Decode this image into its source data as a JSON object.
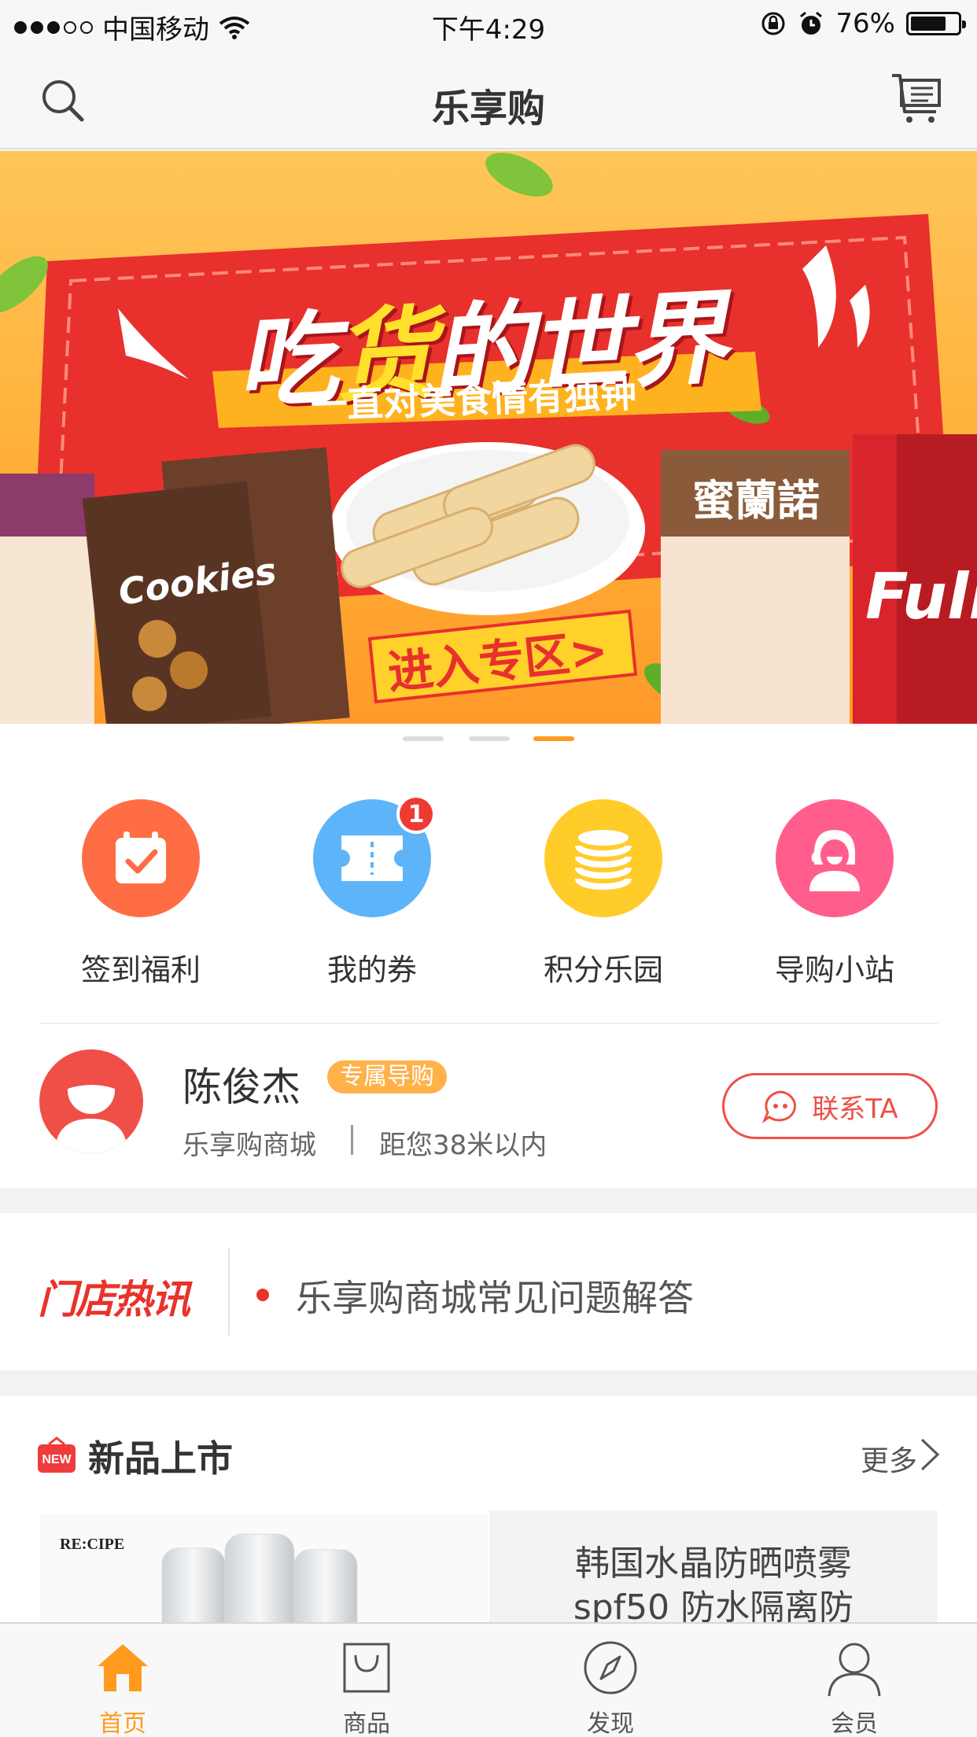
{
  "status_bar": {
    "carrier": "中国移动",
    "time": "下午4:29",
    "battery": "76%",
    "battery_level": 0.76
  },
  "nav": {
    "title": "乐享购"
  },
  "banner": {
    "headline_part1": "吃",
    "headline_part2": "货",
    "headline_part3": "的世界",
    "subline": "一直对美食情有独钟",
    "cta": "进入专区>",
    "carousel_count": 3,
    "carousel_active": 3,
    "brand_text_1": "蜜蘭諾",
    "brand_text_2": "Cookies",
    "brand_text_3": "Full"
  },
  "quick_menu": [
    {
      "label": "签到福利",
      "color": "#ff6d45",
      "icon": "calendar-check-icon"
    },
    {
      "label": "我的券",
      "color": "#5db4f9",
      "icon": "ticket-icon",
      "badge": "1"
    },
    {
      "label": "积分乐园",
      "color": "#ffcc2a",
      "icon": "coins-icon"
    },
    {
      "label": "导购小站",
      "color": "#ff5e8c",
      "icon": "guide-girl-icon"
    }
  ],
  "guide": {
    "name": "陈俊杰",
    "tag": "专属导购",
    "store": "乐享购商城",
    "distance": "距您38米以内",
    "contact": "联系TA"
  },
  "news": {
    "logo": "门店热讯",
    "headline": "乐享购商城常见问题解答"
  },
  "new_products": {
    "icon_text": "NEW",
    "title": "新品上市",
    "more": "更多",
    "item": {
      "brand": "RE:CIPE",
      "name_line1": "韩国水晶防晒喷雾",
      "name_line2": "spf50 防水隔离防"
    }
  },
  "tabbar": [
    {
      "label": "首页",
      "icon": "home-icon",
      "active": true
    },
    {
      "label": "商品",
      "icon": "bag-icon",
      "active": false
    },
    {
      "label": "发现",
      "icon": "compass-icon",
      "active": false
    },
    {
      "label": "会员",
      "icon": "user-icon",
      "active": false
    }
  ],
  "colors": {
    "accent": "#ff9a1f",
    "brand_red": "#ef4f47"
  }
}
